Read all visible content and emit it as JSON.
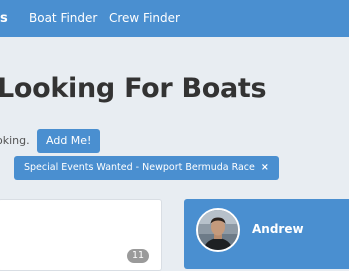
{
  "nav": {
    "logo_fragment": "s",
    "links": [
      "Boat Finder",
      "Crew Finder"
    ]
  },
  "page": {
    "title": "Looking For Boats"
  },
  "status": {
    "text": "oking.",
    "add_button": "Add Me!"
  },
  "filters": {
    "prefix": ":",
    "active": [
      {
        "label": "Special Events Wanted - Newport Bermuda Race",
        "remove_glyph": "×"
      }
    ]
  },
  "results": {
    "count": "11"
  },
  "profile": {
    "name": "Andrew"
  },
  "colors": {
    "accent": "#4a8fd0",
    "background": "#e8edf2",
    "title": "#333333",
    "badge": "#9a9a9a"
  }
}
